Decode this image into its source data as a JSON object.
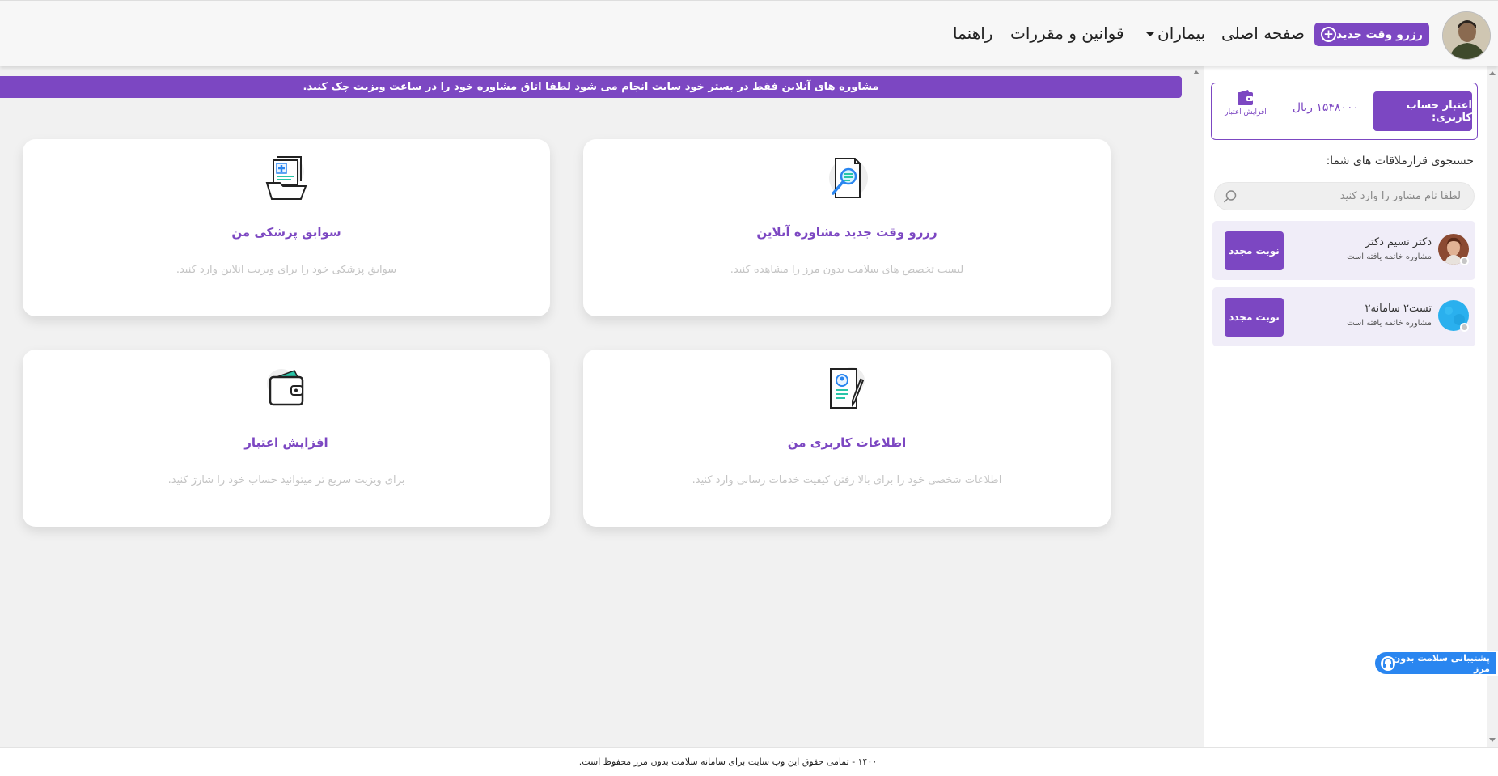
{
  "nav": {
    "new_booking": "رزرو وقت جدید",
    "home": "صفحه اصلی",
    "patients": "بیماران",
    "rules": "قوانین و مقررات",
    "help": "راهنما"
  },
  "banner": "مشاوره های آنلاین فقط در بستر خود سایت انجام می شود لطفا اتاق مشاوره خود را در ساعت ویزیت چک کنید.",
  "cards": [
    {
      "title": "رزرو وقت جدید مشاوره آنلاین",
      "desc": "لیست تخصص های سلامت بدون مرز را مشاهده کنید.",
      "icon": "document-search-icon"
    },
    {
      "title": "سوابق پزشکی من",
      "desc": "سوابق پزشکی خود را برای ویزیت انلاین وارد کنید.",
      "icon": "medical-records-icon"
    },
    {
      "title": "اطلاعات کاربری من",
      "desc": "اطلاعات شخصی خود را برای بالا رفتن کیفیت خدمات رسانی وارد کنید.",
      "icon": "user-profile-form-icon"
    },
    {
      "title": "افزایش اعتبار",
      "desc": "برای ویزیت سریع تر میتوانید حساب خود را شارژ کنید.",
      "icon": "wallet-icon"
    }
  ],
  "sidebar": {
    "credit_label": "اعتبار حساب کاربری:",
    "credit_amount": "۱۵۴۸۰۰۰ ریال",
    "increase_credit": "افزایش اعتبار",
    "search_title": "جستجوی قرارملاقات های شما:",
    "search_placeholder": "لطفا نام مشاور را وارد کنید",
    "appointments": [
      {
        "name": "دکتر نسیم دکتر",
        "status": "مشاوره خاتمه یافته است",
        "action": "نوبت مجدد"
      },
      {
        "name": "تست۲ سامانه۲",
        "status": "مشاوره خاتمه یافته است",
        "action": "نوبت مجدد"
      }
    ]
  },
  "support": "پشتیبانی سلامت بدون مرز",
  "footer": "۱۴۰۰ - تمامی حقوق این وب سایت برای سامانه سلامت بدون مرز محفوظ است.",
  "colors": {
    "accent": "#7c47c2",
    "support": "#2a86f0",
    "background": "#f1f1f1"
  }
}
